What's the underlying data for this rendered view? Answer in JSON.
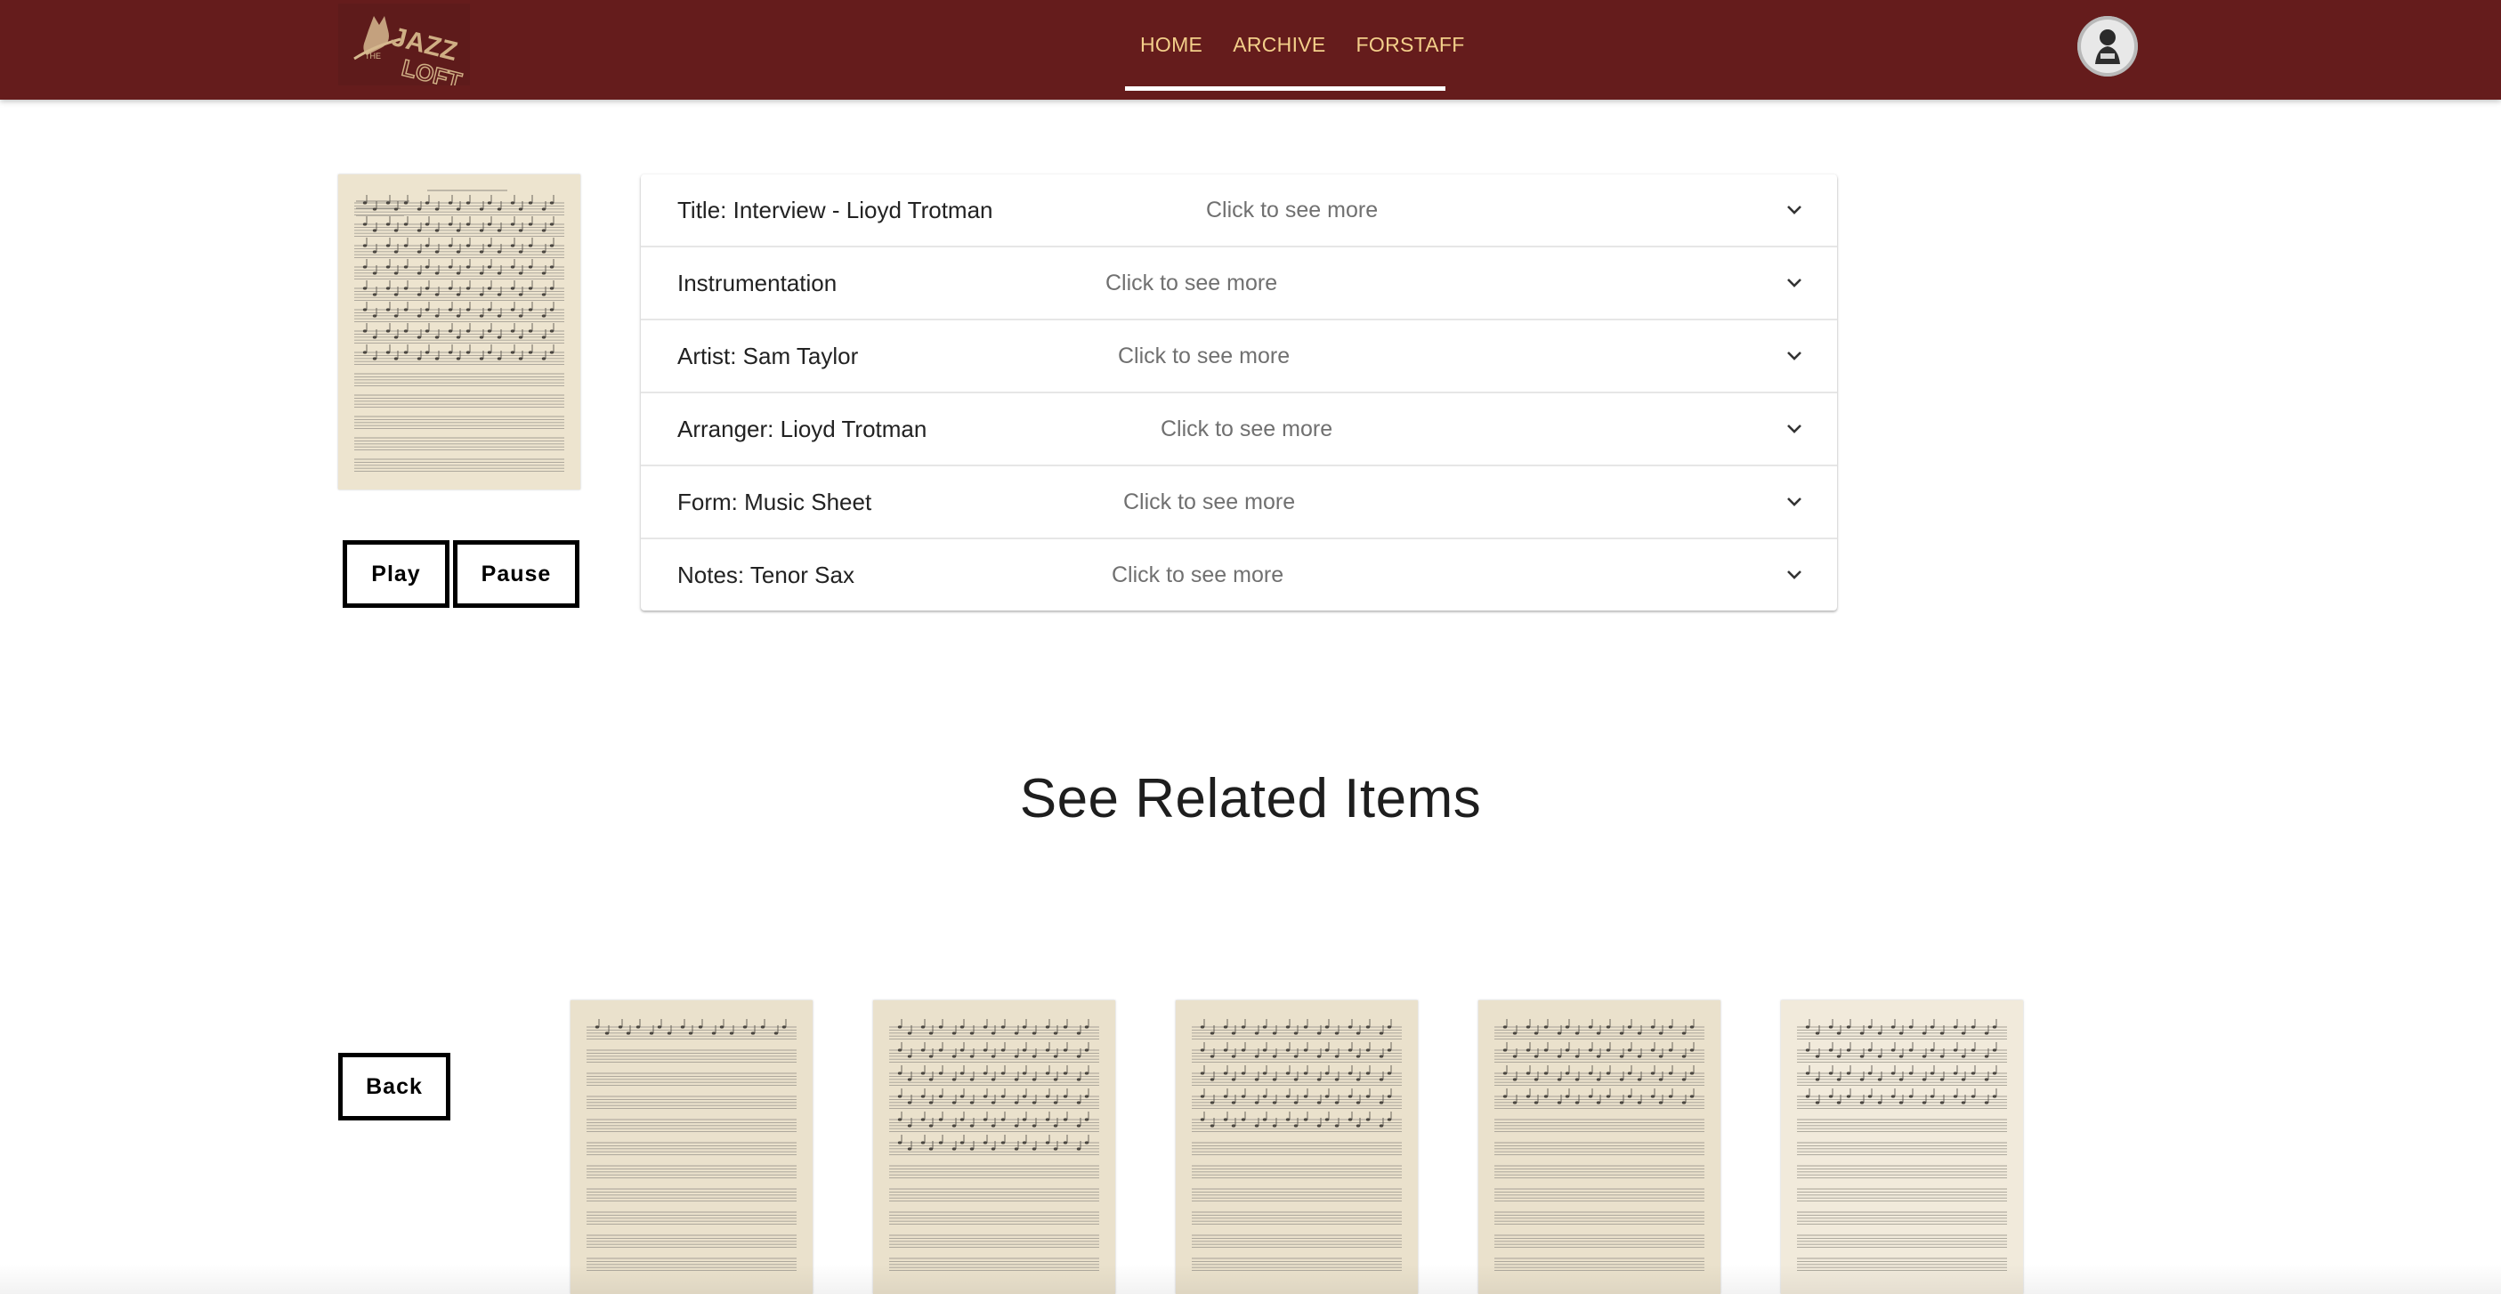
{
  "header": {
    "logo_alt": "The Jazz Loft",
    "nav": [
      {
        "label": "HOME"
      },
      {
        "label": "ARCHIVE"
      },
      {
        "label": "FORSTAFF"
      }
    ],
    "colors": {
      "bar": "#651c1c",
      "nav_text": "#f3cf8a",
      "active_underline": "#ffffff"
    }
  },
  "player": {
    "play_label": "Play",
    "pause_label": "Pause"
  },
  "details": {
    "rows": [
      {
        "label": "Title: Interview - Lioyd Trotman",
        "hint": "Click to see more"
      },
      {
        "label": "Instrumentation",
        "hint": "Click to see more"
      },
      {
        "label": "Artist: Sam Taylor",
        "hint": "Click to see more"
      },
      {
        "label": "Arranger: Lioyd Trotman",
        "hint": "Click to see more"
      },
      {
        "label": "Form: Music Sheet",
        "hint": "Click to see more"
      },
      {
        "label": "Notes: Tenor Sax",
        "hint": "Click to see more"
      }
    ],
    "icon": "chevron-down-icon"
  },
  "related": {
    "title": "See Related Items",
    "back_label": "Back",
    "items_count_visible": 5
  }
}
